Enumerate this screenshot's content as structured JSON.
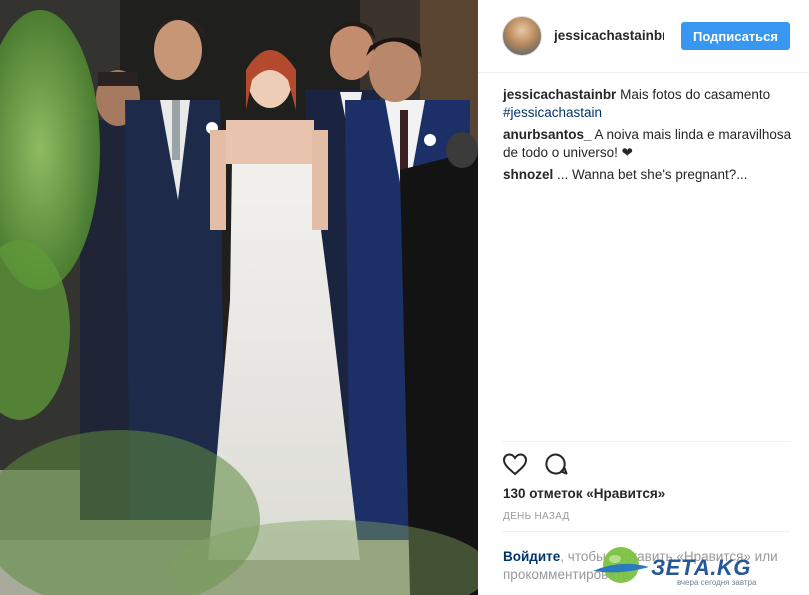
{
  "post": {
    "image_alt": "Wedding group photo",
    "header": {
      "username": "jessicachastainbr",
      "follow_label": "Подписаться"
    },
    "comments": [
      {
        "author": "jessicachastainbr",
        "text": " Mais fotos do casamento ",
        "hashtag": "#jessicachastain"
      },
      {
        "author": "anurbsantos_",
        "text": " A noiva mais linda e maravilhosa de todo o universo! ❤"
      },
      {
        "author": "shnozel",
        "text": " ... Wanna bet she's pregnant?..."
      }
    ],
    "likes_label": "130 отметок «Нравится»",
    "time_label": "ДЕНЬ НАЗАД",
    "login_prompt": {
      "login_link": "Войдите",
      "rest": ", чтобы поставить «Нравится» или прокомментировать"
    }
  },
  "watermark": {
    "brand": "ЗЕТА.KG",
    "tagline": "вчера сегодня завтра"
  },
  "icons": {
    "like": "heart-outline-icon",
    "comment": "comment-bubble-icon"
  },
  "colors": {
    "follow_button": "#3897f0",
    "hashtag": "#003569",
    "meta_gray": "#999999"
  }
}
